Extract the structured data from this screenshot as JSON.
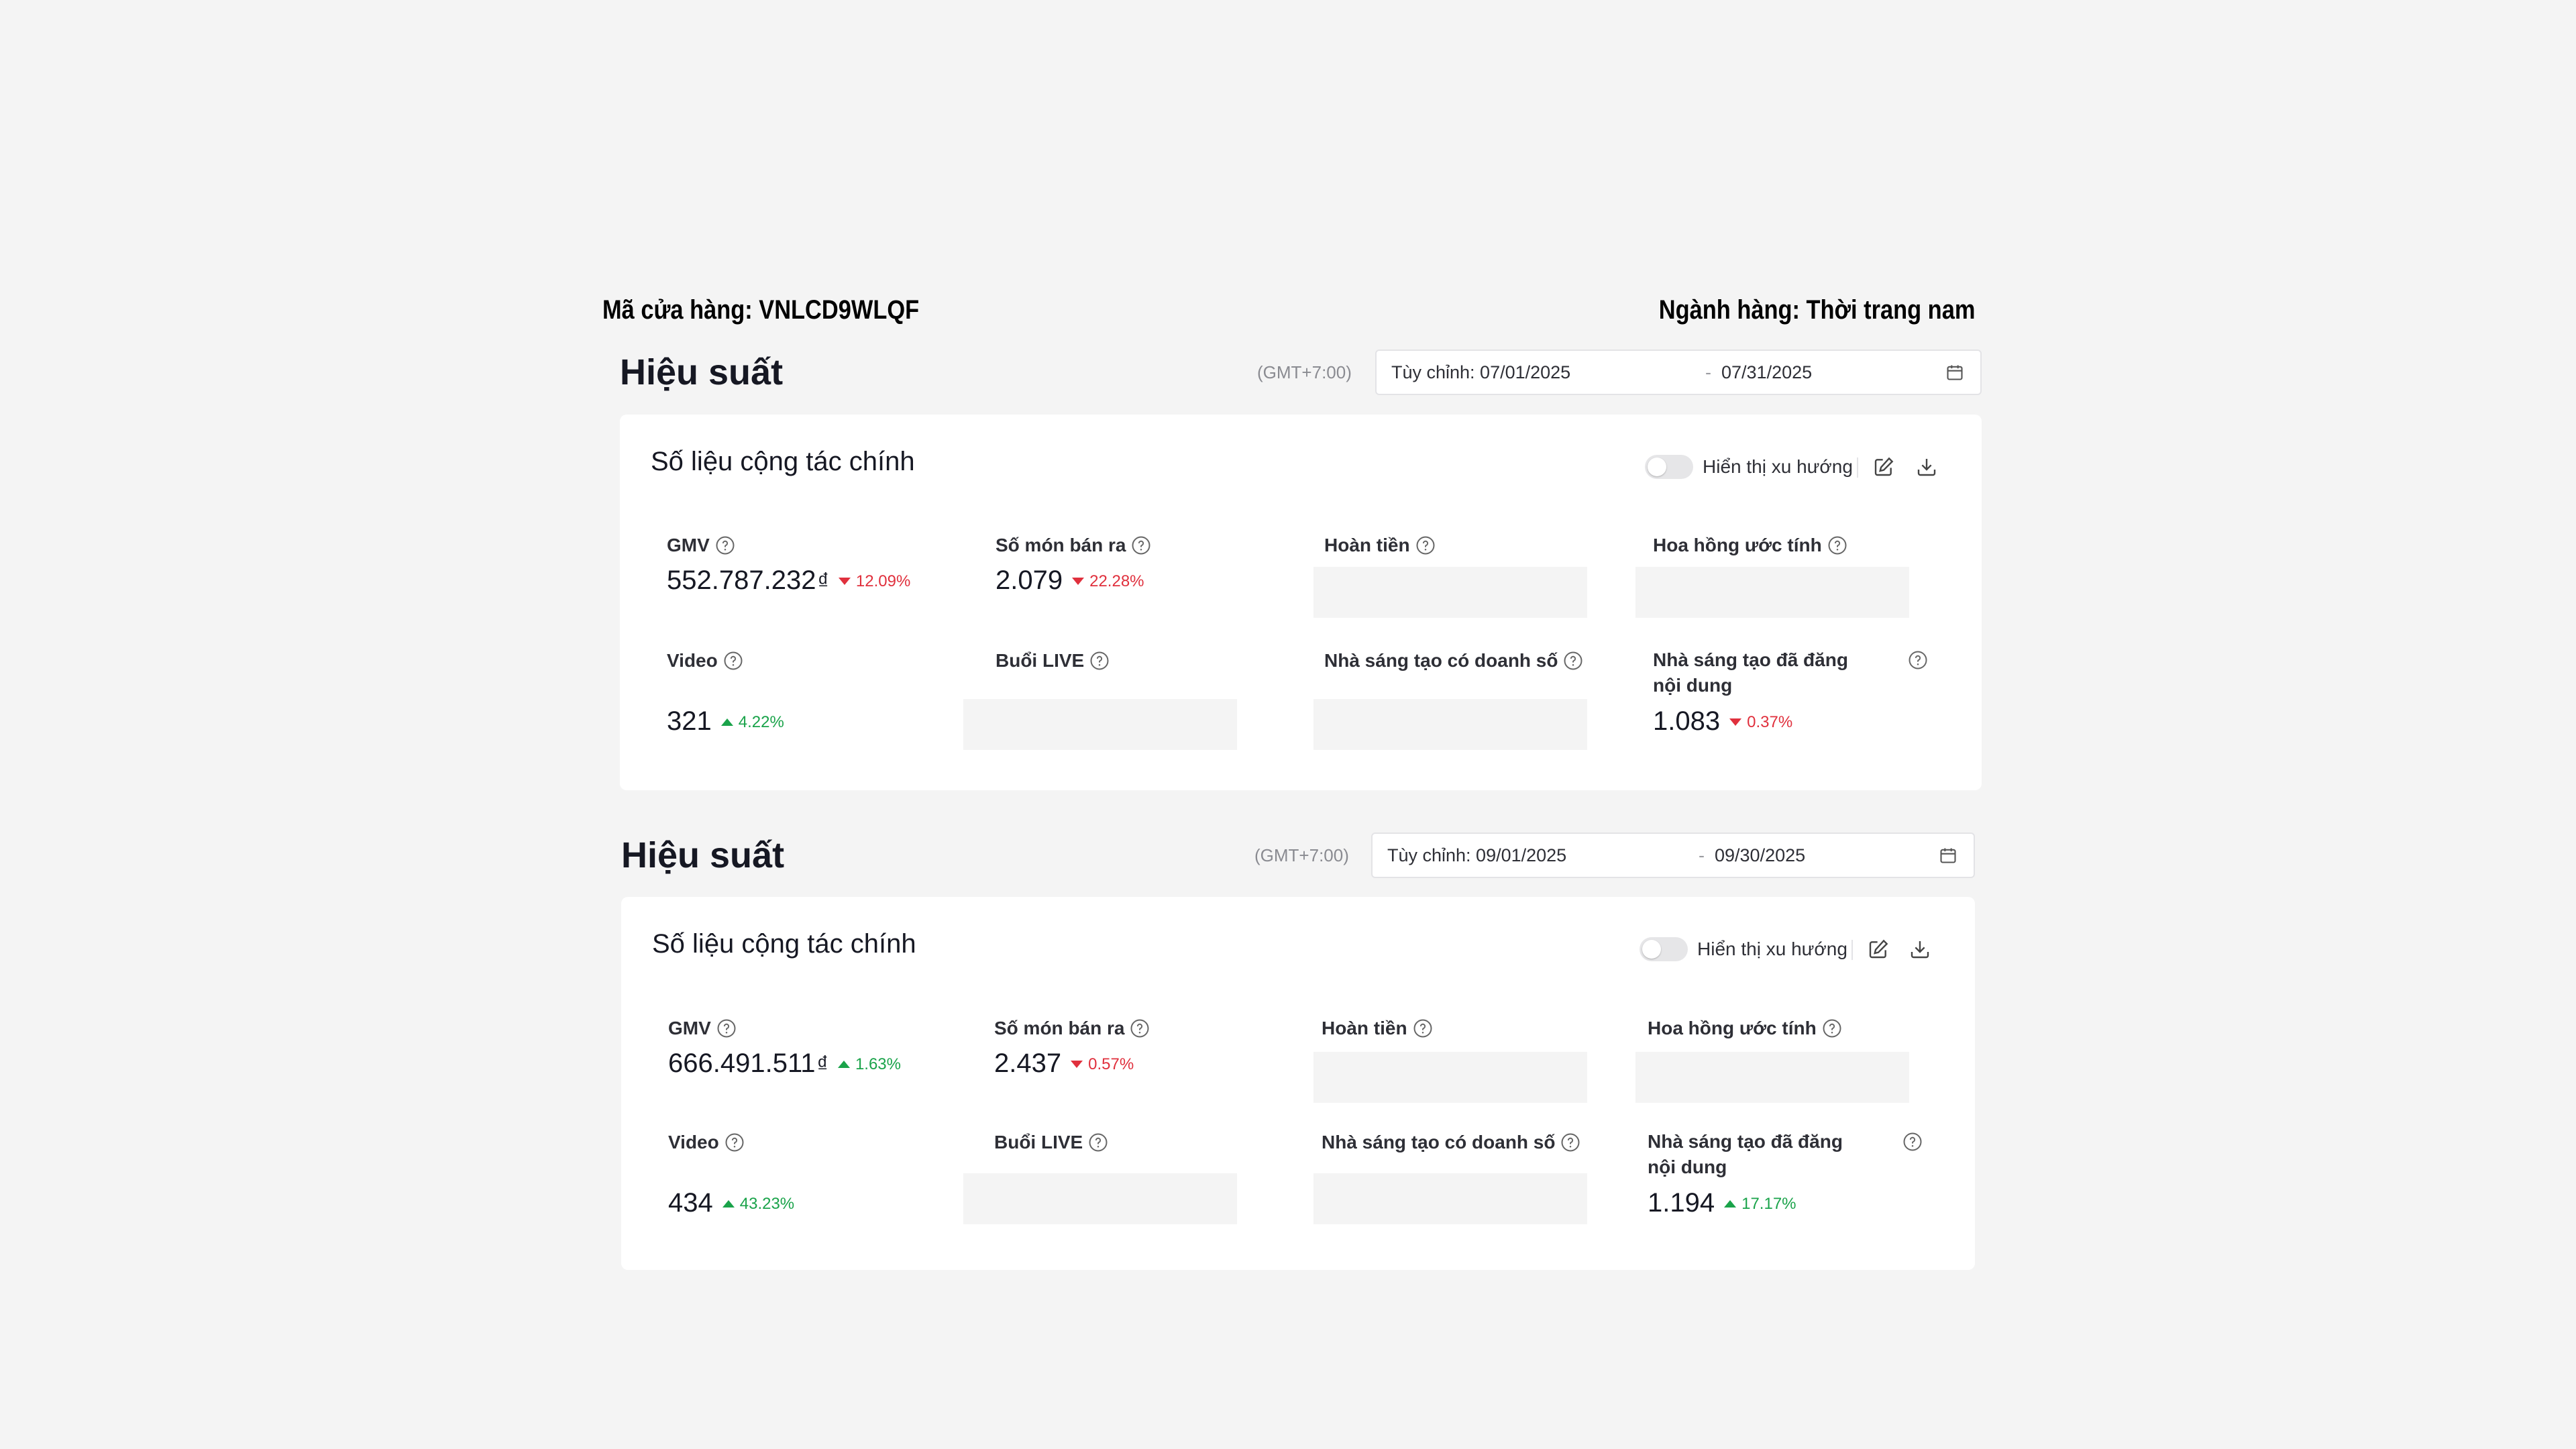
{
  "store": {
    "code": "Mã cửa hàng: VNLCD9WLQF",
    "category": "Ngành hàng: Thời trang nam"
  },
  "sections": [
    {
      "title": "Hiệu suất",
      "timezone": "(GMT+7:00)",
      "date_start": "Tùy chỉnh: 07/01/2025",
      "date_sep": "-",
      "date_end": "07/31/2025",
      "card_title": "Số liệu cộng tác chính",
      "toggle_label": "Hiển thị xu hướng",
      "toggle_on": false,
      "metrics": {
        "gmv": {
          "label": "GMV",
          "value": "552.787.232",
          "currency": "₫",
          "trend": "12.09%",
          "direction": "down"
        },
        "items_sold": {
          "label": "Số món bán ra",
          "value": "2.079",
          "trend": "22.28%",
          "direction": "down"
        },
        "refund": {
          "label": "Hoàn tiền"
        },
        "commission": {
          "label": "Hoa hồng ước tính"
        },
        "video": {
          "label": "Video",
          "value": "321",
          "trend": "4.22%",
          "direction": "up"
        },
        "live": {
          "label": "Buổi LIVE"
        },
        "creators_sales": {
          "label": "Nhà sáng tạo có doanh số"
        },
        "creators_posted": {
          "label": "Nhà sáng tạo đã đăng nội dung",
          "value": "1.083",
          "trend": "0.37%",
          "direction": "down"
        }
      }
    },
    {
      "title": "Hiệu suất",
      "timezone": "(GMT+7:00)",
      "date_start": "Tùy chỉnh: 09/01/2025",
      "date_sep": "-",
      "date_end": "09/30/2025",
      "card_title": "Số liệu cộng tác chính",
      "toggle_label": "Hiển thị xu hướng",
      "toggle_on": false,
      "metrics": {
        "gmv": {
          "label": "GMV",
          "value": "666.491.511",
          "currency": "₫",
          "trend": "1.63%",
          "direction": "up"
        },
        "items_sold": {
          "label": "Số món bán ra",
          "value": "2.437",
          "trend": "0.57%",
          "direction": "down"
        },
        "refund": {
          "label": "Hoàn tiền"
        },
        "commission": {
          "label": "Hoa hồng ước tính"
        },
        "video": {
          "label": "Video",
          "value": "434",
          "trend": "43.23%",
          "direction": "up"
        },
        "live": {
          "label": "Buổi LIVE"
        },
        "creators_sales": {
          "label": "Nhà sáng tạo có doanh số"
        },
        "creators_posted": {
          "label": "Nhà sáng tạo đã đăng nội dung",
          "value": "1.194",
          "trend": "17.17%",
          "direction": "up"
        }
      }
    }
  ],
  "colors": {
    "background": "#f4f4f4",
    "card": "#ffffff",
    "trend_down": "#e0303d",
    "trend_up": "#1aa34a",
    "placeholder": "#f4f4f4"
  },
  "icons": {
    "help": "question-circle-icon",
    "calendar": "calendar-icon",
    "edit": "edit-icon",
    "download": "download-icon"
  }
}
